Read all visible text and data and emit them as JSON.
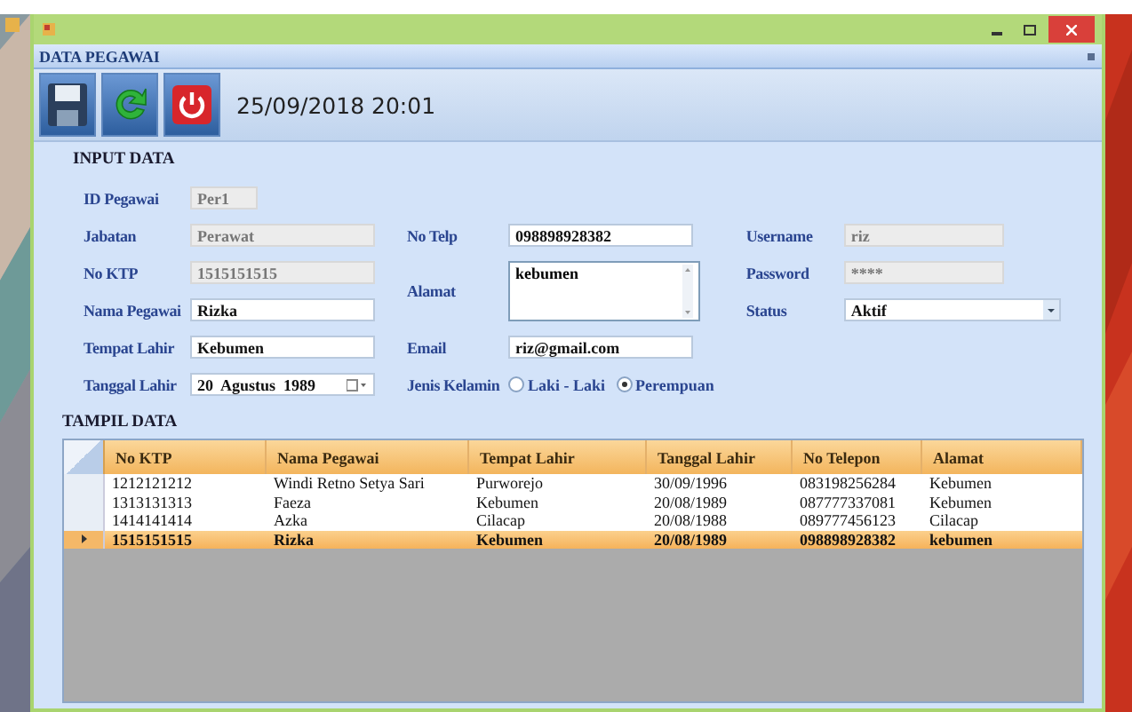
{
  "panel": {
    "title": "DATA PEGAWAI"
  },
  "toolbar": {
    "buttons": [
      {
        "kind": "save"
      },
      {
        "kind": "refresh"
      },
      {
        "kind": "power"
      }
    ],
    "datetime": "25/09/2018 20:01"
  },
  "input_data": {
    "title": "INPUT DATA",
    "columns": [
      [
        {
          "label": "ID Pegawai",
          "kind": "text",
          "value": "Per1",
          "disabled": true
        },
        {
          "label": "Jabatan",
          "kind": "text",
          "value": "Perawat",
          "disabled": true
        },
        {
          "label": "No KTP",
          "kind": "text",
          "value": "1515151515",
          "disabled": true
        },
        {
          "label": "Nama Pegawai",
          "kind": "text",
          "value": "Rizka",
          "disabled": false
        },
        {
          "label": "Tempat Lahir",
          "kind": "text",
          "value": "Kebumen",
          "disabled": false
        },
        {
          "label": "Tanggal Lahir",
          "kind": "date",
          "value": "20  Agustus  1989",
          "disabled": false
        }
      ],
      [
        {
          "label": "No Telp",
          "kind": "text",
          "value": "098898928382",
          "disabled": false
        },
        {
          "label": "Alamat",
          "kind": "textarea",
          "value": "kebumen",
          "disabled": false
        },
        {
          "label": "Email",
          "kind": "text",
          "value": "riz@gmail.com",
          "disabled": false
        },
        {
          "label": "Jenis Kelamin",
          "kind": "radio",
          "options": [
            {
              "label": "Laki - Laki",
              "selected": false
            },
            {
              "label": "Perempuan",
              "selected": true
            }
          ]
        }
      ],
      [
        {
          "label": "Username",
          "kind": "text",
          "value": "riz",
          "disabled": true
        },
        {
          "label": "Password",
          "kind": "text",
          "value": "****",
          "disabled": true
        },
        {
          "label": "Status",
          "kind": "select",
          "value": "Aktif",
          "disabled": false
        }
      ]
    ]
  },
  "table": {
    "title": "TAMPIL DATA",
    "columns": [
      "No KTP",
      "Nama Pegawai",
      "Tempat Lahir",
      "Tanggal Lahir",
      "No Telepon",
      "Alamat"
    ],
    "rows": [
      {
        "cells": [
          "1212121212",
          "Windi Retno Setya Sari",
          "Purworejo",
          "30/09/1996",
          "083198256284",
          "Kebumen"
        ],
        "selected": false
      },
      {
        "cells": [
          "1313131313",
          "Faeza",
          "Kebumen",
          "20/08/1989",
          "087777337081",
          "Kebumen"
        ],
        "selected": false
      },
      {
        "cells": [
          "1414141414",
          "Azka",
          "Cilacap",
          "20/08/1988",
          "089777456123",
          "Cilacap"
        ],
        "selected": false
      },
      {
        "cells": [
          "1515151515",
          "Rizka",
          "Kebumen",
          "20/08/1989",
          "098898928382",
          "kebumen"
        ],
        "selected": true
      }
    ]
  }
}
